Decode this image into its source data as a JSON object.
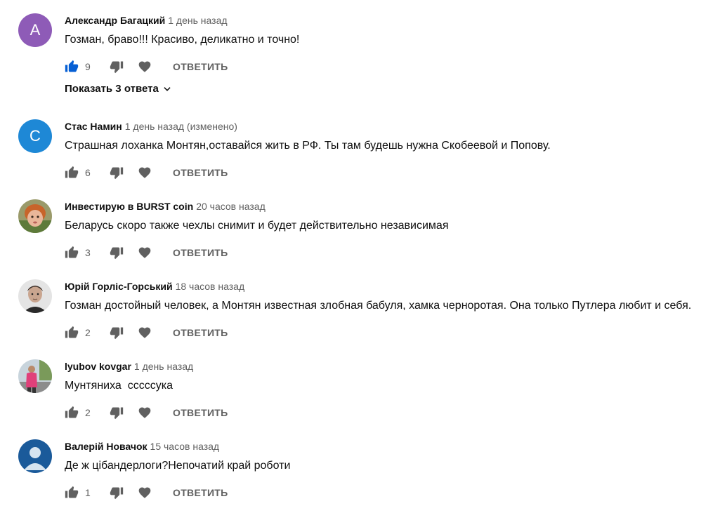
{
  "ui": {
    "reply_label": "ОТВЕТИТЬ",
    "show_replies_label": "Показать 3 ответа",
    "colors": {
      "liked_blue": "#065fd4",
      "icon_gray": "#606060",
      "avatar_purple": "#8e5bb7",
      "avatar_blue": "#1e88d6"
    }
  },
  "comments": [
    {
      "author": "Александр Багацкий",
      "time": "1 день назад",
      "text": "Гозман, браво!!! Красиво, деликатно и точно!",
      "likes": "9",
      "liked": true,
      "avatar_letter": "A",
      "avatar_icon": "letter-avatar"
    },
    {
      "author": "Стас Намин",
      "time": "1 день назад (изменено)",
      "text": "Страшная лоханка Монтян,оставайся жить в РФ. Ты там будешь нужна Скобеевой и Попову.",
      "likes": "6",
      "liked": false,
      "avatar_letter": "C",
      "avatar_icon": "letter-avatar"
    },
    {
      "author": "Инвестирую в BURST coin",
      "time": "20 часов назад",
      "text": "Беларусь скоро также чехлы снимит и будет действительно независимая",
      "likes": "3",
      "liked": false,
      "avatar_icon": "child-photo-avatar"
    },
    {
      "author": "Юрій Горліс-Горський",
      "time": "18 часов назад",
      "text": "Гозман достойный человек, а Монтян известная злобная бабуля, хамка черноротая. Она только Путлера любит и себя.",
      "likes": "2",
      "liked": false,
      "avatar_icon": "portrait-photo-avatar"
    },
    {
      "author": "lyubov kovgar",
      "time": "1 день назад",
      "text": "Мунтяниха  сссссука",
      "likes": "2",
      "liked": false,
      "avatar_icon": "person-outdoor-photo-avatar"
    },
    {
      "author": "Валерій Новачок",
      "time": "15 часов назад",
      "text": "Де ж цібандерлоги?Непочатий край роботи",
      "likes": "1",
      "liked": false,
      "avatar_icon": "default-user-avatar"
    }
  ]
}
